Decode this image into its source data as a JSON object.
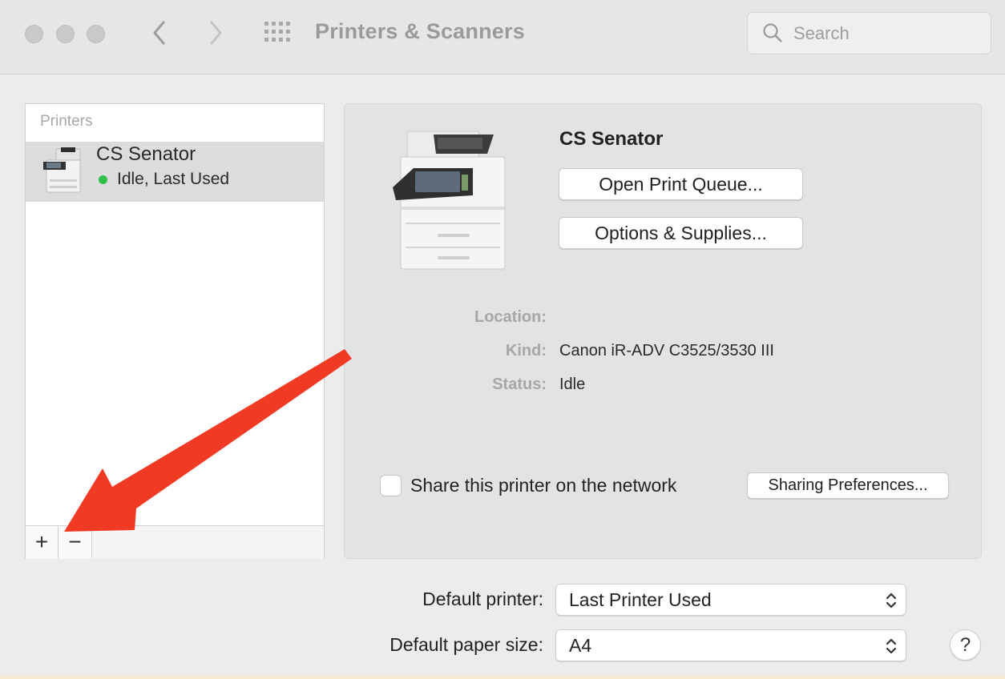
{
  "window": {
    "title": "Printers & Scanners",
    "search_placeholder": "Search"
  },
  "toolbar": {
    "back_icon": "chevron-left-icon",
    "forward_icon": "chevron-right-icon",
    "grid_icon": "show-all-grid-icon"
  },
  "printers_list": {
    "header": "Printers",
    "items": [
      {
        "name": "CS Senator",
        "status": "Idle, Last Used",
        "status_color": "#2fbf4a",
        "selected": true
      }
    ],
    "add_label": "+",
    "remove_label": "−"
  },
  "detail": {
    "printer_name": "CS Senator",
    "open_queue_label": "Open Print Queue...",
    "options_supplies_label": "Options & Supplies...",
    "location_label": "Location:",
    "location_value": "",
    "kind_label": "Kind:",
    "kind_value": "Canon iR-ADV C3525/3530 III",
    "status_label": "Status:",
    "status_value": "Idle",
    "share_label": "Share this printer on the network",
    "share_checked": false,
    "sharing_prefs_label": "Sharing Preferences..."
  },
  "defaults": {
    "printer_label": "Default printer:",
    "printer_value": "Last Printer Used",
    "paper_label": "Default paper size:",
    "paper_value": "A4"
  },
  "help_label": "?",
  "annotation": {
    "arrow_color": "#f03a23"
  }
}
